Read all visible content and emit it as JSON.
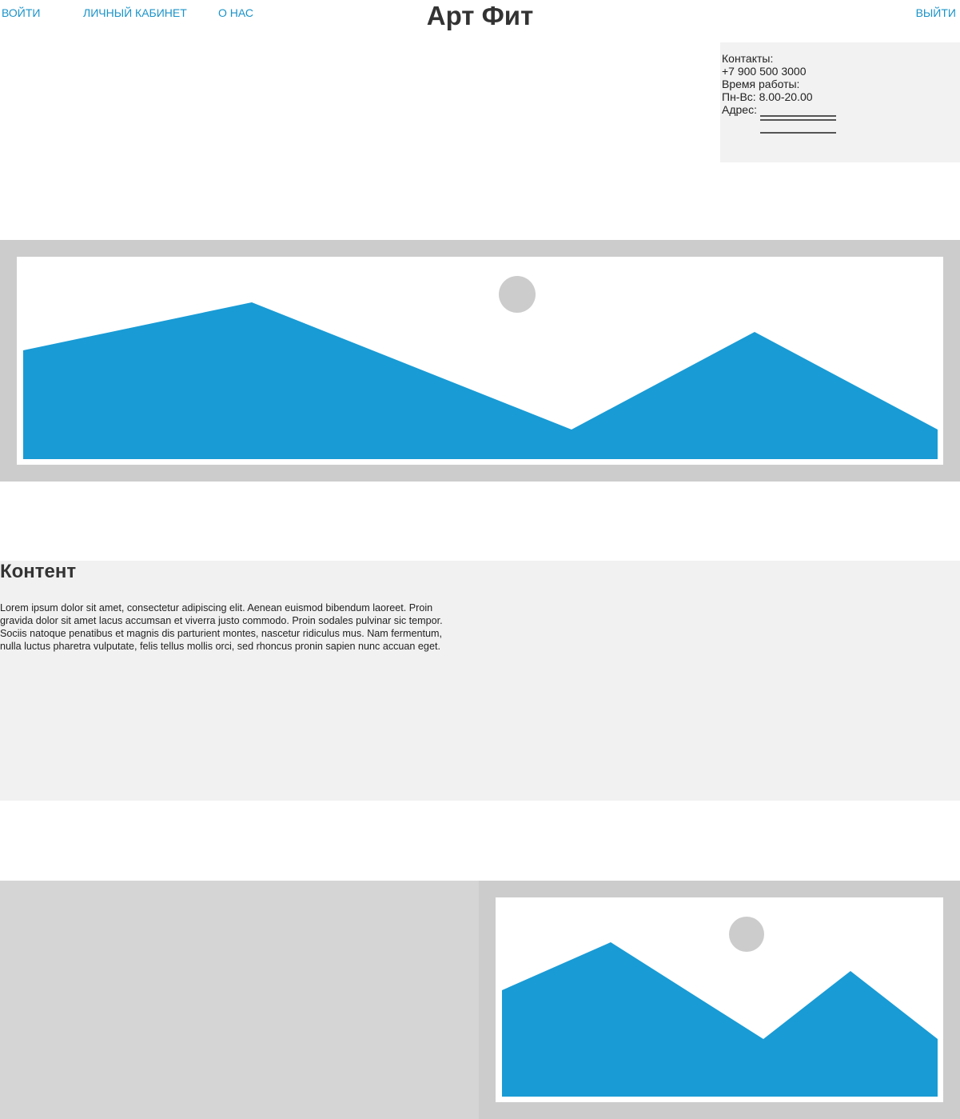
{
  "nav": {
    "login": "ВОЙТИ",
    "account": "ЛИЧНЫЙ КАБИНЕТ",
    "about": "О НАС",
    "logout": "ВЫЙТИ"
  },
  "site": {
    "title": "Арт Фит"
  },
  "contacts": {
    "label": "Контакты:",
    "phone": "+7 900 500 3000",
    "hours_label": "Время работы:",
    "hours_value": "Пн-Вс: 8.00-20.00",
    "address_label": "Адрес:"
  },
  "content": {
    "title": "Контент",
    "body": "Lorem ipsum dolor sit amet, consectetur adipiscing elit. Aenean euismod bibendum laoreet. Proin gravida dolor sit amet lacus accumsan et viverra justo commodo. Proin sodales pulvinar sic tempor. Sociis natoque penatibus et magnis dis parturient montes, nascetur ridiculus mus. Nam fermentum, nulla luctus pharetra vulputate, felis tellus mollis orci, sed rhoncus pronin sapien nunc accuan eget."
  },
  "colors": {
    "link": "#1a93c9",
    "placeholder_mountain": "#199bd5",
    "placeholder_sun": "#cccccc",
    "band_gray": "#cccccc",
    "section_gray": "#f1f1f1"
  },
  "icons": {
    "hero": "image-placeholder-icon",
    "bottom": "image-placeholder-icon"
  }
}
